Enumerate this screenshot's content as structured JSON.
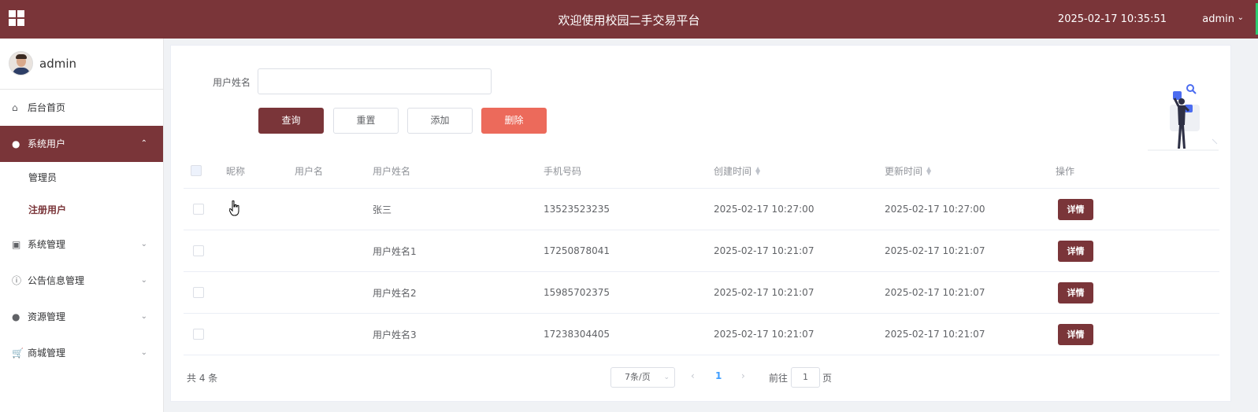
{
  "header": {
    "title": "欢迎使用校园二手交易平台",
    "datetime": "2025-02-17 10:35:51",
    "user": "admin",
    "user_chevron": "⌄"
  },
  "sidebar": {
    "user_name": "admin",
    "items": [
      {
        "label": "后台首页",
        "icon": "home-icon",
        "glyph": "⌂"
      },
      {
        "label": "系统用户",
        "icon": "user-icon",
        "glyph": "●",
        "expanded": true,
        "children": [
          {
            "label": "管理员"
          },
          {
            "label": "注册用户",
            "current": true
          }
        ]
      },
      {
        "label": "系统管理",
        "icon": "image-icon",
        "glyph": "▣"
      },
      {
        "label": "公告信息管理",
        "icon": "info-icon",
        "glyph": "ⓘ"
      },
      {
        "label": "资源管理",
        "icon": "bulb-icon",
        "glyph": "●"
      },
      {
        "label": "商城管理",
        "icon": "cart-icon",
        "glyph": "🛒"
      }
    ],
    "chevron_up": "⌃",
    "chevron_down": "⌄"
  },
  "search": {
    "label": "用户姓名",
    "value": "",
    "placeholder": ""
  },
  "buttons": {
    "query": "查询",
    "reset": "重置",
    "add": "添加",
    "delete": "删除"
  },
  "table": {
    "columns": [
      "昵称",
      "用户名",
      "用户姓名",
      "手机号码",
      "创建时间",
      "更新时间",
      "操作"
    ],
    "sortable": [
      "创建时间",
      "更新时间"
    ],
    "action_label": "详情",
    "rows": [
      {
        "nickname": "",
        "username": "",
        "realname": "张三",
        "phone": "13523523235",
        "created": "2025-02-17 10:27:00",
        "updated": "2025-02-17 10:27:00"
      },
      {
        "nickname": "",
        "username": "",
        "realname": "用户姓名1",
        "phone": "17250878041",
        "created": "2025-02-17 10:21:07",
        "updated": "2025-02-17 10:21:07"
      },
      {
        "nickname": "",
        "username": "",
        "realname": "用户姓名2",
        "phone": "15985702375",
        "created": "2025-02-17 10:21:07",
        "updated": "2025-02-17 10:21:07"
      },
      {
        "nickname": "",
        "username": "",
        "realname": "用户姓名3",
        "phone": "17238304405",
        "created": "2025-02-17 10:21:07",
        "updated": "2025-02-17 10:21:07"
      }
    ]
  },
  "pagination": {
    "total": "共 4 条",
    "page_size": "7条/页",
    "prev": "‹",
    "current_page": "1",
    "next": "›",
    "goto_prefix": "前往",
    "goto_value": "1",
    "goto_suffix": "页"
  },
  "colors": {
    "brand": "#7a3539",
    "danger": "#ec6a5b",
    "link": "#409eff"
  }
}
